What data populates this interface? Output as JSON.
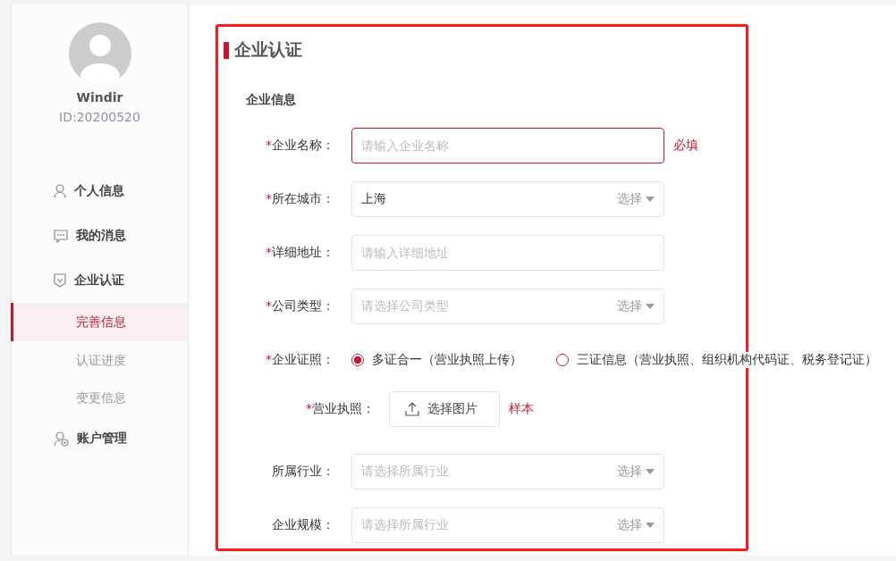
{
  "sidebar": {
    "profile": {
      "name": "Windir",
      "id": "ID:20200520"
    },
    "menu": [
      {
        "label": "个人信息"
      },
      {
        "label": "我的消息"
      },
      {
        "label": "企业认证",
        "children": [
          {
            "label": "完善信息",
            "selected": true
          },
          {
            "label": "认证进度",
            "selected": false
          },
          {
            "label": "变更信息",
            "selected": false
          }
        ]
      },
      {
        "label": "账户管理"
      }
    ]
  },
  "page": {
    "title": "企业认证",
    "section": "企业信息"
  },
  "form": [
    {
      "kind": "input",
      "mark": "*",
      "label": "企业名称：",
      "placeholder": "请输入企业名称",
      "error": true,
      "hint": "必填"
    },
    {
      "kind": "select",
      "mark": "*",
      "label": "所在城市：",
      "value": "上海",
      "action": "选择"
    },
    {
      "kind": "input",
      "mark": "*",
      "label": "详细地址：",
      "placeholder": "请输入详细地址",
      "error": false
    },
    {
      "kind": "select",
      "mark": "*",
      "label": "公司类型：",
      "placeholder": "请选择公司类型",
      "action": "选择"
    },
    {
      "kind": "radio",
      "mark": "*",
      "label": "企业证照：",
      "options": [
        {
          "label": "多证合一（营业执照上传）",
          "selected": true
        },
        {
          "label": "三证信息（营业执照、组织机构代码证、税务登记证）",
          "selected": false
        }
      ]
    },
    {
      "kind": "upload",
      "mark": "*",
      "label": "营业执照：",
      "button": "选择图片",
      "link": "样本"
    },
    {
      "kind": "select",
      "label": "所属行业：",
      "placeholder": "请选择所属行业",
      "action": "选择"
    },
    {
      "kind": "select",
      "label": "企业规模：",
      "placeholder": "请选择所属行业",
      "action": "选择"
    }
  ]
}
